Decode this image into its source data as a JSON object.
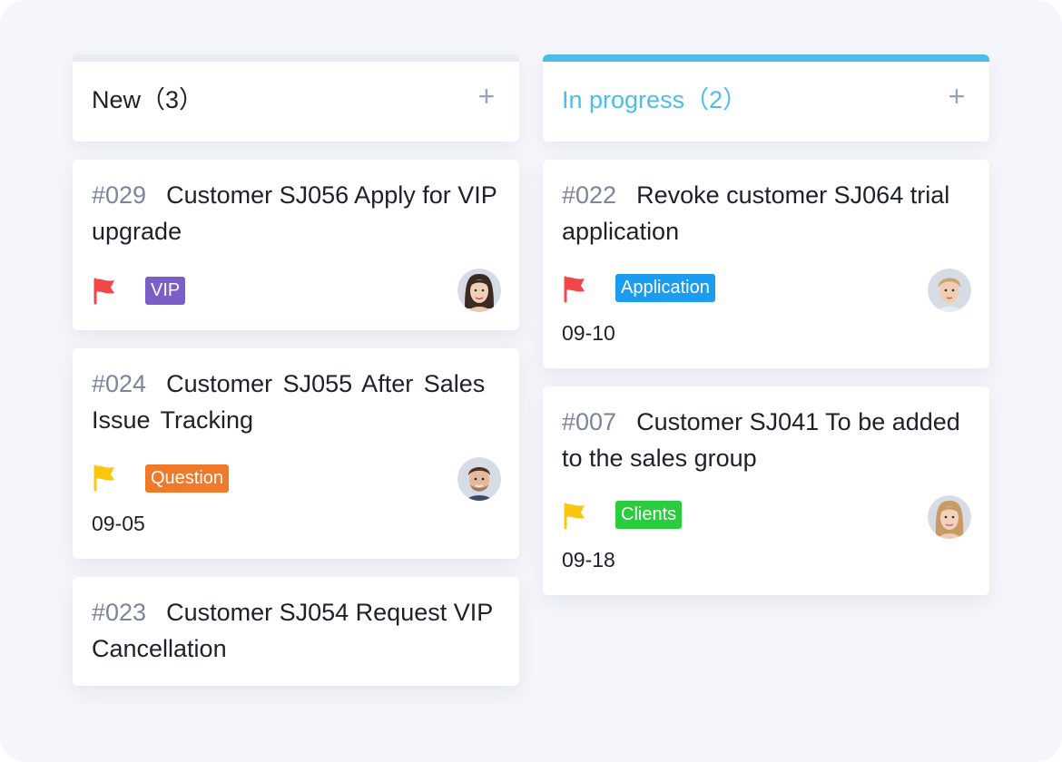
{
  "columns": [
    {
      "name": "New",
      "count": "（3）",
      "accent": "#e8ebf2",
      "title_color": "#1d2129",
      "cards": [
        {
          "id": "#029",
          "title": "Customer SJ056 Apply for VIP upgrade",
          "flag_color": "#f04848",
          "tag": "VIP",
          "tag_color": "#7b5ec6",
          "date": "",
          "avatar": "woman-dark-hair"
        },
        {
          "id": "#024",
          "title": "Customer SJ055 After Sales Issue Tracking",
          "flag_color": "#f9c80e",
          "tag": "Question",
          "tag_color": "#f07a2a",
          "date": "09-05",
          "avatar": "man-beard"
        },
        {
          "id": "#023",
          "title": "Customer SJ054 Request VIP Cancellation"
        }
      ]
    },
    {
      "name": "In progress",
      "count": "（2）",
      "accent": "#4cbdea",
      "title_color": "#4cbdea",
      "cards": [
        {
          "id": "#022",
          "title": "Revoke customer SJ064 trial application",
          "flag_color": "#f04848",
          "tag": "Application",
          "tag_color": "#1a9cf0",
          "date": "09-10",
          "avatar": "man-blond"
        },
        {
          "id": "#007",
          "title": "Customer SJ041 To be added to the sales group",
          "flag_color": "#f9c80e",
          "tag": "Clients",
          "tag_color": "#28cc3c",
          "date": "09-18",
          "avatar": "woman-blonde"
        }
      ]
    }
  ],
  "add_label": "+"
}
